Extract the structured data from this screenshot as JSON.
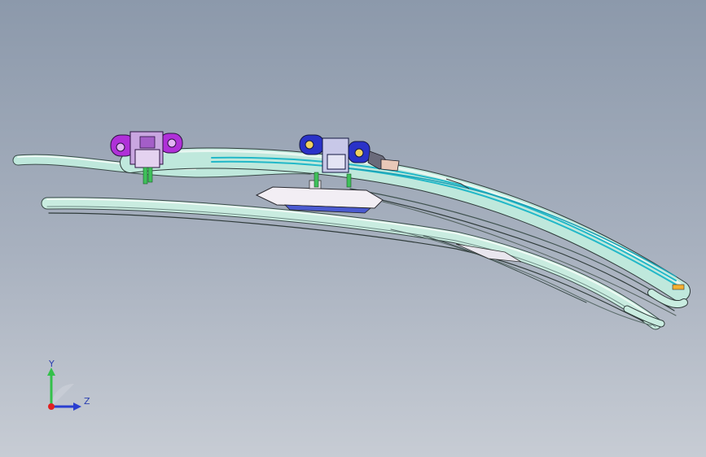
{
  "viewport": {
    "background_top": "#8c99ab",
    "background_bottom": "#c7ccd4"
  },
  "model": {
    "parts": [
      {
        "name": "upper-rail-assembly",
        "color": "#bfe8dc"
      },
      {
        "name": "lower-rail-assembly",
        "color": "#c9ece0"
      },
      {
        "name": "left-bracket",
        "color": "#b030d8"
      },
      {
        "name": "right-bracket",
        "color": "#2a32c8"
      },
      {
        "name": "center-clip-block",
        "color": "#f2eef4"
      },
      {
        "name": "accent-stripes",
        "color": "#22b8c8"
      },
      {
        "name": "mounting-studs",
        "color": "#3ec05a"
      }
    ]
  },
  "triad": {
    "y_label": "Y",
    "z_label": "Z",
    "y_color": "#33c04a",
    "z_color": "#2a3fd0",
    "x_color": "#e02020"
  }
}
